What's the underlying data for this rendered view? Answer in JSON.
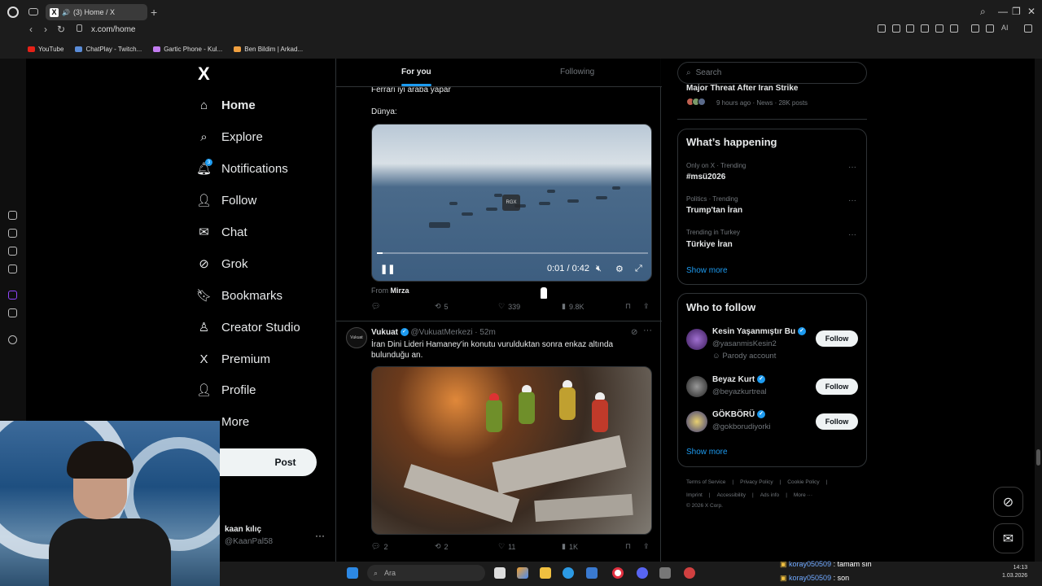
{
  "browser": {
    "tab_title": "(3) Home / X",
    "url": "x.com/home",
    "bookmarks": [
      "YouTube",
      "ChatPlay - Twitch...",
      "Gartic Phone - Kul...",
      "Ben Bildim | Arkad..."
    ]
  },
  "nav": {
    "items": [
      {
        "label": "Home",
        "icon": "home-icon"
      },
      {
        "label": "Explore",
        "icon": "search-icon"
      },
      {
        "label": "Notifications",
        "icon": "bell-icon"
      },
      {
        "label": "Follow",
        "icon": "add-person-icon"
      },
      {
        "label": "Chat",
        "icon": "mail-icon"
      },
      {
        "label": "Grok",
        "icon": "grok-icon"
      },
      {
        "label": "Bookmarks",
        "icon": "bookmark-icon"
      },
      {
        "label": "Creator Studio",
        "icon": "creator-icon"
      },
      {
        "label": "Premium",
        "icon": "x-icon"
      },
      {
        "label": "Profile",
        "icon": "person-icon"
      },
      {
        "label": "More",
        "icon": "more-icon"
      }
    ],
    "notifications_badge": "3",
    "post_label": "Post",
    "account_name": "kaan kılıç",
    "account_handle": "@KaanPal58"
  },
  "feed": {
    "tabs": {
      "selected": "For you",
      "other": "Following"
    },
    "tweet1": {
      "text1": "Ferrari iyi araba yapar",
      "text2": "Dünya:",
      "video_watermark": "RGX",
      "video_time": "0:01 / 0:42",
      "video_progress": 0.02,
      "from_label": "From",
      "from_name": "Mirza",
      "retweets": "5",
      "likes": "339",
      "views": "9.8K"
    },
    "tweet2": {
      "avatar_text": "Vukuat",
      "name": "Vukuat",
      "handle_time": "@VukuatMerkezi · 52m",
      "text": "İran Dini Lideri Hamaney'in konutu vuruldu​ktan sonra enkaz altında bulunduğu an.",
      "replies": "2",
      "retweets": "2",
      "likes": "11",
      "views": "1K"
    }
  },
  "right": {
    "search_placeholder": "Search",
    "top_trend_title": "Major Threat After Iran Strike",
    "top_trend_meta": "9 hours ago · News · 28K posts",
    "happening_title": "What’s happening",
    "trends": [
      {
        "meta": "Only on X · Trending",
        "name": "#msü2026"
      },
      {
        "meta": "Politics · Trending",
        "name": "Trump'tan İran"
      },
      {
        "meta": "Trending in Turkey",
        "name": "Türkiye İran"
      }
    ],
    "show_more": "Show more",
    "who_to_follow_title": "Who to follow",
    "follow_label": "Follow",
    "suggestions": [
      {
        "name": "Kesin Yaşanmıştır Bu",
        "handle": "@yasanmisKesin2",
        "extra": "Parody account"
      },
      {
        "name": "Beyaz Kurt",
        "handle": "@beyazkurtreal",
        "extra": ""
      },
      {
        "name": "GÖKBÖRÜ",
        "handle": "@gokborudiyorki",
        "extra": ""
      }
    ],
    "footer_row1": [
      "Terms of Service",
      "Privacy Policy",
      "Cookie Policy"
    ],
    "footer_row2": [
      "Imprint",
      "Accessibility",
      "Ads info",
      "More ···"
    ],
    "copyright": "© 2026 X Corp."
  },
  "taskbar": {
    "search_label": "Ara",
    "chat": [
      {
        "user": "koray050509",
        "msg": " : tamam sın"
      },
      {
        "user": "koray050509",
        "msg": " : son"
      }
    ],
    "time": "14:13",
    "date": "1.03.2026"
  },
  "colors": {
    "accent": "#1d9bf0",
    "bg": "#000000",
    "border": "#2f3336",
    "muted": "#71767b"
  }
}
